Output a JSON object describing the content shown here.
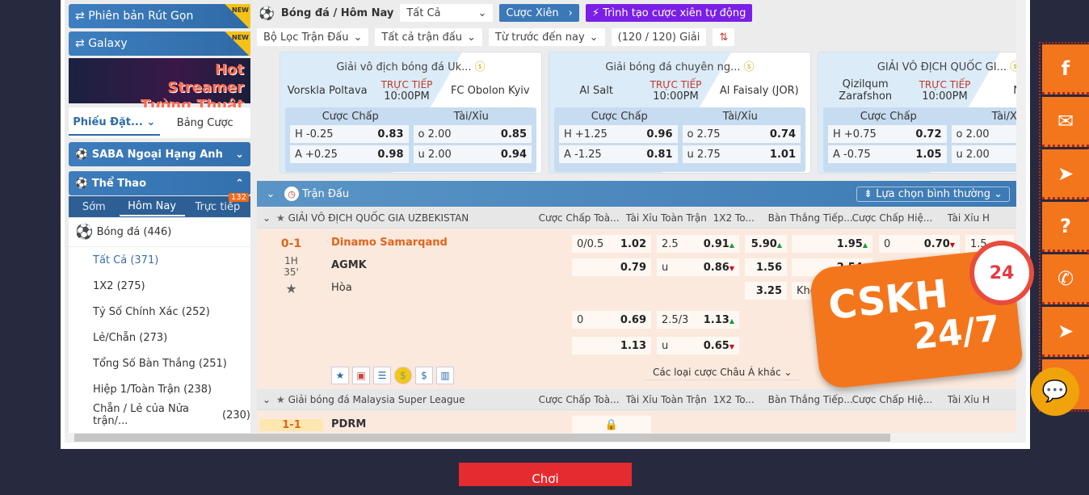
{
  "sidebar": {
    "promo1": "Phiên bản Rút Gọn",
    "promo2": "Galaxy",
    "new_badge": "NEW",
    "banner": "Hot Streamer Tường Thuật",
    "tabs": [
      "Phiếu Đặt...",
      "Bảng Cược"
    ],
    "saba": "SABA Ngoại Hạng Anh",
    "sports": "Thể Thao",
    "subtabs": [
      "Sớm",
      "Hôm Nay",
      "Trực tiếp"
    ],
    "live_count": "132",
    "sport": {
      "name": "Bóng đá",
      "count": "(446)"
    },
    "items": [
      {
        "label": "Tất Cả",
        "count": "(371)"
      },
      {
        "label": "1X2",
        "count": "(275)"
      },
      {
        "label": "Tỷ Số Chính Xác",
        "count": "(252)"
      },
      {
        "label": "Lẻ/Chẵn",
        "count": "(273)"
      },
      {
        "label": "Tổng Số Bàn Thắng",
        "count": "(251)"
      },
      {
        "label": "Hiệp 1/Toàn Trận",
        "count": "(238)"
      },
      {
        "label": "Chẵn / Lẻ của Nửa trận/...",
        "count": "(230)"
      }
    ]
  },
  "header": {
    "title": "Bóng đá / Hôm Nay",
    "filter": "Tất Cả",
    "parlay": "Cược Xiên",
    "auto_parlay": "Trình tạo cược xiên tự động",
    "filters": [
      "Bộ Lọc Trận Đấu",
      "Tất cả trận đấu",
      "Từ trước đến nay"
    ],
    "leagues": "(120 / 120) Giải"
  },
  "cards": [
    {
      "league": "Giải vô địch bóng đá Uk...",
      "home": "Vorskla Poltava",
      "away": "FC Obolon Kyiv",
      "status": "TRỰC TIẾP",
      "time": "10:00PM",
      "h1": "Cược Chấp",
      "h2": "Tài/Xỉu",
      "rows": [
        [
          "H -0.25",
          "0.83",
          "o 2.00",
          "0.85"
        ],
        [
          "A +0.25",
          "0.98",
          "u 2.00",
          "0.94"
        ]
      ]
    },
    {
      "league": "Giải bóng đá chuyên ng...",
      "home": "Al Salt",
      "away": "Al Faisaly (JOR)",
      "status": "TRỰC TIẾP",
      "time": "10:00PM",
      "h1": "Cược Chấp",
      "h2": "Tài/Xỉu",
      "rows": [
        [
          "H +1.25",
          "0.96",
          "o 2.75",
          "0.74"
        ],
        [
          "A -1.25",
          "0.81",
          "u 2.75",
          "1.01"
        ]
      ]
    },
    {
      "league": "GIẢI VÔ ĐỊCH QUỐC GI...",
      "home": "Qizilqum Zarafshon",
      "away": "Nasaf",
      "status": "TRỰC TIẾP",
      "time": "10:00PM",
      "h1": "Cược Chấp",
      "h2": "Tài/Xỉu",
      "rows": [
        [
          "H +0.75",
          "0.72",
          "o 2.00",
          ""
        ],
        [
          "A -0.75",
          "1.05",
          "u 2.00",
          ""
        ]
      ]
    }
  ],
  "section": {
    "title": "Trận Đấu",
    "option": "Lựa chọn bình thường"
  },
  "columns": [
    "Cược Chấp Toà...",
    "Tài Xỉu Toàn Trận",
    "1X2 To...",
    "Bàn Thắng Tiếp...",
    "Cược Chấp Hiệ...",
    "Tài Xỉu H"
  ],
  "match1": {
    "league": "GIẢI VÔ ĐỊCH QUỐC GIA UZBEKISTAN",
    "score": "0-1",
    "period": "1H",
    "minute": "35'",
    "home": "Dinamo Samarqand",
    "away": "AGMK",
    "draw": "Hòa",
    "hdp": [
      [
        "0/0.5",
        "1.02"
      ],
      [
        "",
        "0.79"
      ],
      [
        "0",
        "0.69"
      ],
      [
        "",
        "1.13"
      ]
    ],
    "ou": [
      [
        "2.5",
        "0.91"
      ],
      [
        "u",
        "0.86"
      ],
      [
        "2.5/3",
        "1.13"
      ],
      [
        "u",
        "0.65"
      ]
    ],
    "x12": [
      "5.90",
      "1.56",
      "3.25"
    ],
    "next": [
      "1.95",
      "2.54",
      "Khô"
    ],
    "hhdp": [
      "0",
      "0.70"
    ],
    "hou": "1.5",
    "more": "Các loại cược Châu Á khác"
  },
  "match2": {
    "league": "Giải bóng đá Malaysia Super League",
    "score": "1-1",
    "home": "PDRM"
  },
  "cskh": {
    "line1": "CSKH",
    "line2": "24/7",
    "badge": "24"
  },
  "play_button": "Chơi",
  "colors": {
    "primary": "#3d7dbd",
    "accent": "#f4761c",
    "purple": "#7a1fe6"
  }
}
